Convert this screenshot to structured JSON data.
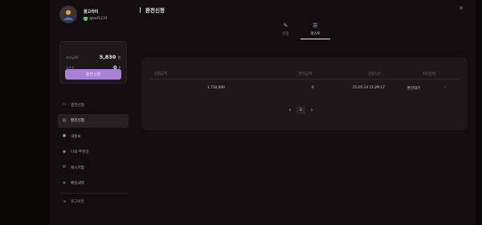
{
  "profile": {
    "name": "쿨고라미",
    "user_id": "qbwf1231"
  },
  "balance": {
    "holding_label": "보유금액",
    "holding_value": "5,830",
    "holding_unit": "원",
    "points_label": "포인트",
    "points_value": "0",
    "points_unit": "P",
    "exchange_button": "충전신청"
  },
  "sidebar": {
    "items": [
      {
        "label": "충전신청",
        "icon": "wallet-icon",
        "active": false
      },
      {
        "label": "환전신청",
        "icon": "card-icon",
        "active": true
      },
      {
        "label": "내정보",
        "icon": "user-icon",
        "active": false
      },
      {
        "label": "나의 추천인",
        "icon": "people-icon",
        "active": false
      },
      {
        "label": "메시지함",
        "icon": "mail-icon",
        "active": false
      },
      {
        "label": "베팅내역",
        "icon": "list-icon",
        "active": false
      }
    ],
    "logout": "로그아웃"
  },
  "header": {
    "title": "환전신청",
    "close": "×"
  },
  "tabs": [
    {
      "label": "신청",
      "icon": "pencil-icon",
      "active": false
    },
    {
      "label": "리스트",
      "icon": "list-icon",
      "active": true
    }
  ],
  "table": {
    "columns": [
      "신청금액",
      "환전금액",
      "신청시간",
      "처리상태"
    ],
    "rows": [
      {
        "request_amount": "1,710,000",
        "exchange_amount": "0",
        "time": "25.05.14 21:29:17",
        "status": "환전대기",
        "action": "-"
      }
    ]
  },
  "pagination": {
    "current": "1",
    "prev": "‹",
    "next": "›"
  }
}
